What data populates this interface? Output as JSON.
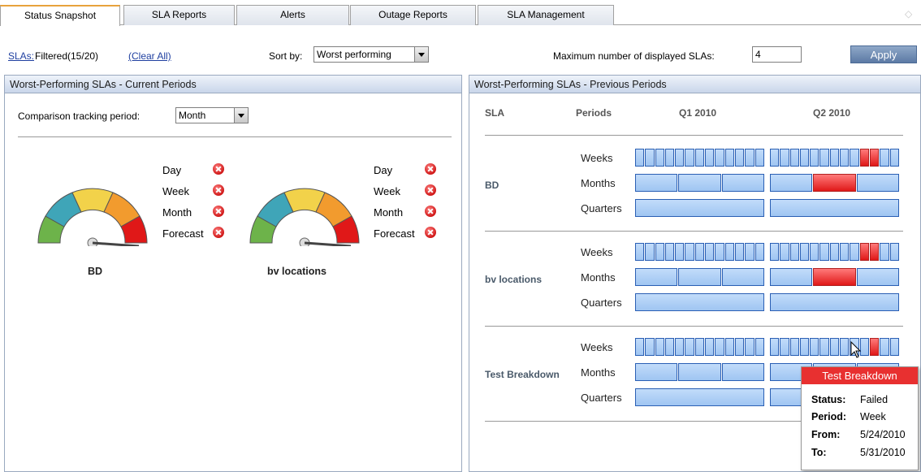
{
  "tabs": [
    {
      "label": "Status Snapshot",
      "active": true
    },
    {
      "label": "SLA Reports"
    },
    {
      "label": "Alerts"
    },
    {
      "label": "Outage Reports"
    },
    {
      "label": "SLA Management"
    }
  ],
  "toolbar": {
    "slas_link": "SLAs:",
    "filtered": "Filtered(15/20)",
    "clear_all": "(Clear All)",
    "sort_label": "Sort by:",
    "sort_value": "Worst performing",
    "max_label": "Maximum number of displayed SLAs:",
    "max_value": "4",
    "apply": "Apply"
  },
  "left_panel": {
    "title": "Worst-Performing SLAs - Current Periods",
    "tracking_label": "Comparison tracking period:",
    "tracking_value": "Month",
    "gauges": [
      {
        "name": "BD",
        "statuses": [
          {
            "label": "Day",
            "status": "failed"
          },
          {
            "label": "Week",
            "status": "failed"
          },
          {
            "label": "Month",
            "status": "failed"
          },
          {
            "label": "Forecast",
            "status": "failed"
          }
        ]
      },
      {
        "name": "bv locations",
        "statuses": [
          {
            "label": "Day",
            "status": "failed"
          },
          {
            "label": "Week",
            "status": "failed"
          },
          {
            "label": "Month",
            "status": "failed"
          },
          {
            "label": "Forecast",
            "status": "failed"
          }
        ]
      }
    ]
  },
  "right_panel": {
    "title": "Worst-Performing SLAs - Previous Periods",
    "columns": {
      "sla": "SLA",
      "periods": "Periods",
      "q1": "Q1 2010",
      "q2": "Q2 2010"
    },
    "period_labels": [
      "Weeks",
      "Months",
      "Quarters"
    ],
    "rows": [
      {
        "name": "BD",
        "weeks_q1_failed": [],
        "weeks_q2_failed": [
          9,
          10
        ],
        "months_q2_failed": [
          1
        ]
      },
      {
        "name": "bv locations",
        "weeks_q1_failed": [],
        "weeks_q2_failed": [
          9,
          10
        ],
        "months_q2_failed": [
          1
        ]
      },
      {
        "name": "Test Breakdown",
        "weeks_q1_failed": [],
        "weeks_q2_failed": [
          10
        ],
        "months_q2_failed": []
      }
    ]
  },
  "tooltip": {
    "title": "Test Breakdown",
    "status_label": "Status:",
    "status_value": "Failed",
    "period_label": "Period:",
    "period_value": "Week",
    "from_label": "From:",
    "from_value": "5/24/2010",
    "to_label": "To:",
    "to_value": "5/31/2010"
  },
  "colors": {
    "failed": "#e01818",
    "ok": "#9fc5f2",
    "tab_accent": "#e8a23c"
  }
}
